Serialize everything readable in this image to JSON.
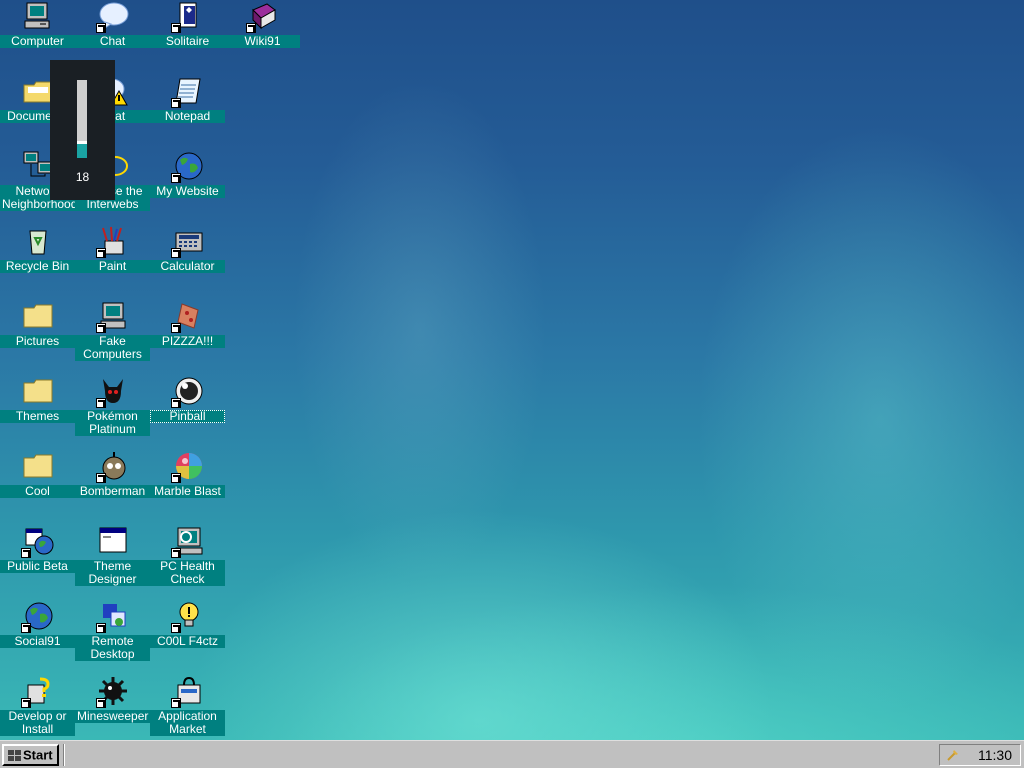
{
  "desktop": {
    "icons": [
      {
        "label": "Computer",
        "icon": "computer-icon"
      },
      {
        "label": "Chat",
        "icon": "chat-bubble-icon"
      },
      {
        "label": "Solitaire",
        "icon": "solitaire-cards-icon"
      },
      {
        "label": "Wiki91",
        "icon": "book-icon"
      },
      {
        "label": "Documents",
        "icon": "folder-documents-icon"
      },
      {
        "label": "Chat",
        "icon": "chat-warning-icon"
      },
      {
        "label": "Notepad",
        "icon": "notepad-icon"
      },
      {
        "label": "Network Neighborhood",
        "icon": "network-icon"
      },
      {
        "label": "Browse the Interwebs",
        "icon": "internet-icon"
      },
      {
        "label": "My Website",
        "icon": "globe-icon"
      },
      {
        "label": "Recycle Bin",
        "icon": "recycle-bin-icon"
      },
      {
        "label": "Paint",
        "icon": "paint-icon"
      },
      {
        "label": "Calculator",
        "icon": "calculator-icon"
      },
      {
        "label": "Pictures",
        "icon": "folder-icon"
      },
      {
        "label": "Fake Computers",
        "icon": "computer-icon"
      },
      {
        "label": "PIZZZA!!!",
        "icon": "pizza-icon"
      },
      {
        "label": "Themes",
        "icon": "folder-icon"
      },
      {
        "label": "Pokémon Platinum",
        "icon": "pokemon-icon"
      },
      {
        "label": "Pinball",
        "icon": "pinball-icon"
      },
      {
        "label": "Cool",
        "icon": "folder-icon"
      },
      {
        "label": "Bomberman",
        "icon": "bomberman-icon"
      },
      {
        "label": "Marble Blast",
        "icon": "marble-icon"
      },
      {
        "label": "Public Beta",
        "icon": "globe-window-icon"
      },
      {
        "label": "Theme Designer",
        "icon": "window-icon"
      },
      {
        "label": "PC Health Check",
        "icon": "health-check-icon"
      },
      {
        "label": "Social91",
        "icon": "globe-icon"
      },
      {
        "label": "Remote Desktop",
        "icon": "remote-desktop-icon"
      },
      {
        "label": "C00L F4ctz",
        "icon": "lightbulb-icon"
      },
      {
        "label": "Develop or Install",
        "icon": "help-setup-icon"
      },
      {
        "label": "Minesweeper",
        "icon": "mine-icon"
      },
      {
        "label": "Application Market",
        "icon": "market-bag-icon"
      }
    ]
  },
  "volume": {
    "value": "18",
    "level_fraction": 0.18
  },
  "taskbar": {
    "start_label": "Start",
    "clock": "11:30",
    "tray_icon": "volume-tray-icon"
  },
  "colors": {
    "label_bg": "#008080",
    "taskbar": "#c0c0c0",
    "volume_fill": "#1aa3a3"
  }
}
